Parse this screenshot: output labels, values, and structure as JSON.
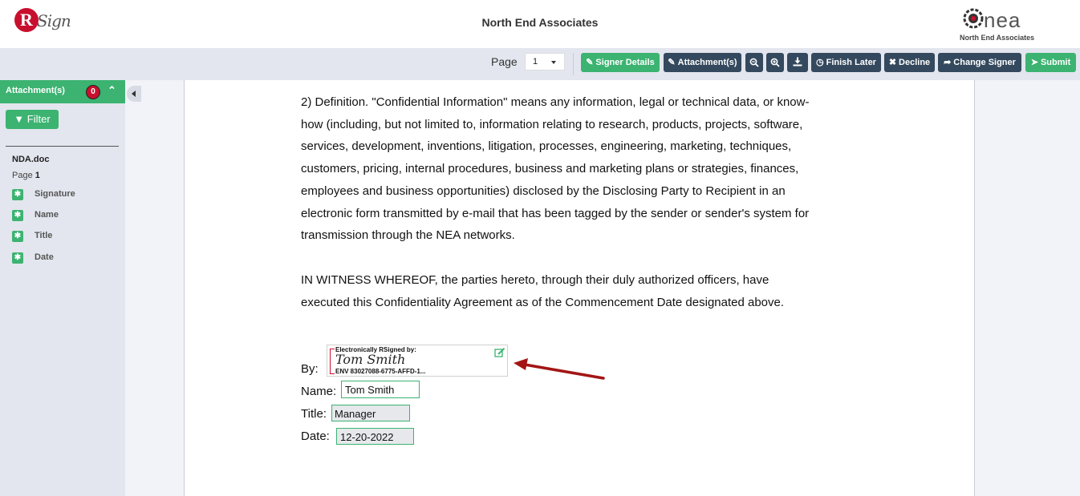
{
  "header": {
    "title": "North End Associates",
    "logo_left_letter": "R",
    "logo_left_text": "Sign",
    "logo_right_text": "nea",
    "logo_right_sub": "North End Associates"
  },
  "toolbar": {
    "page_label": "Page",
    "page_value": "1",
    "buttons": {
      "signer_details": "Signer Details",
      "attachments": "Attachment(s)",
      "finish_later": "Finish Later",
      "decline": "Decline",
      "change_signer": "Change Signer",
      "submit": "Submit"
    },
    "icons": {
      "zoom_out": "zoom-out-icon",
      "zoom_in": "zoom-in-icon",
      "download": "download-icon"
    }
  },
  "sidebar": {
    "attachments_title": "Attachment(s)",
    "attachments_count": "0",
    "filter_label": "Filter",
    "document_name": "NDA.doc",
    "page_prefix": "Page",
    "page_number": "1",
    "fields": [
      {
        "label": "Signature"
      },
      {
        "label": "Name"
      },
      {
        "label": "Title"
      },
      {
        "label": "Date"
      }
    ]
  },
  "document": {
    "paragraph1": [
      "2) Definition.  \"Confidential Information\" means any information, legal or technical data, or know-",
      "how (including, but not limited to, information relating to research, products, projects, software,",
      "services, development, inventions, litigation, processes, engineering, marketing, techniques,",
      "customers, pricing, internal procedures, business and marketing plans or strategies, finances,",
      "employees and business opportunities) disclosed by the Disclosing Party to Recipient in an",
      "electronic form transmitted by e-mail that has been tagged by the sender or sender's system for",
      "transmission through the NEA networks."
    ],
    "paragraph2": [
      "IN WITNESS WHEREOF, the parties hereto, through their duly authorized officers, have",
      "executed this Confidentiality Agreement as of the Commencement Date designated above."
    ],
    "by_label": "By:",
    "signature": {
      "header": "Electronically RSigned by:",
      "name": "Tom Smith",
      "envelope": "ENV 83027088-6775-AFFD-1..."
    },
    "name_label": "Name:",
    "name_value": "Tom Smith",
    "title_label": "Title:",
    "title_value": "Manager",
    "date_label": "Date:",
    "date_value": "12-20-2022"
  },
  "colors": {
    "accent_green": "#3cb371",
    "toolbar_dark": "#34495e",
    "brand_red": "#c8102e",
    "arrow_red": "#a31515"
  }
}
